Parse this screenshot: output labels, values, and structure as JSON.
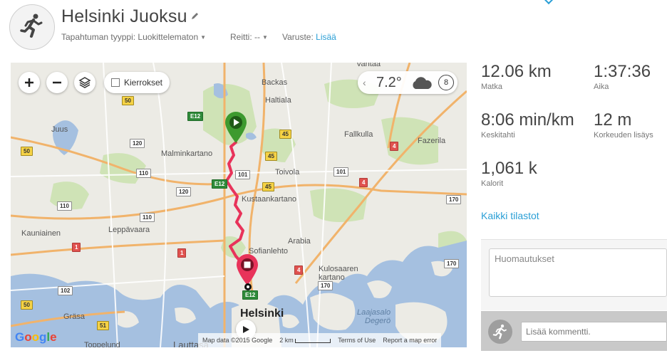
{
  "activity": {
    "title": "Helsinki Juoksu",
    "type_label": "Tapahtuman tyyppi:",
    "type_value": "Luokittelematon",
    "route_label": "Reitti:",
    "route_value": "--",
    "gear_label": "Varuste:",
    "gear_link": "Lisää"
  },
  "map": {
    "laps_label": "Kierrokset",
    "weather": {
      "temperature": "7.2°",
      "wind": "8",
      "condition_icon": "cloud-icon"
    },
    "labels": {
      "vantaa": "Vantaa",
      "backas": "Backas",
      "haltiala": "Haltiala",
      "juus": "Juus",
      "malminkartano": "Malminkartano",
      "fallkulla": "Fallkulla",
      "fazerila": "Fazerila",
      "toivola": "Toivola",
      "kustaankartano": "Kustaankartano",
      "kauniainen": "Kauniainen",
      "leppavaara": "Leppävaara",
      "arabia": "Arabia",
      "sofianlehto": "Sofianlehto",
      "kulosaaren_kartano": "Kulosaaren\nkartano",
      "helsinki": "Helsinki",
      "grasa": "Gräsa",
      "laajasalo": "Laajasalo",
      "degero": "Degerö",
      "toppelund": "Toppelund",
      "lauttasaari": "Lauttasa"
    },
    "shields": {
      "r50a": "50",
      "r50b": "50",
      "r50c": "50",
      "e12a": "E12",
      "e12b": "E12",
      "e12c": "E12",
      "r120a": "120",
      "r120b": "120",
      "r110a": "110",
      "r110b": "110",
      "r110c": "110",
      "r101a": "101",
      "r101b": "101",
      "r45a": "45",
      "r45b": "45",
      "r45c": "45",
      "r4a": "4",
      "r4b": "4",
      "r4c": "4",
      "r170a": "170",
      "r170b": "170",
      "r170c": "170",
      "r1a": "1",
      "r1b": "1",
      "r102": "102",
      "r51": "51"
    },
    "google_logo": "Google",
    "attribution": {
      "map_data": "Map data ©2015 Google",
      "scale": "2 km",
      "terms": "Terms of Use",
      "report": "Report a map error"
    },
    "colors": {
      "route": "#e8335a",
      "start": "#3d9a2e",
      "end": "#e8335a"
    }
  },
  "stats": {
    "distance": {
      "value": "12.06 km",
      "label": "Matka"
    },
    "time": {
      "value": "1:37:36",
      "label": "Aika"
    },
    "pace": {
      "value": "8:06 min/km",
      "label": "Keskitahti"
    },
    "elevation": {
      "value": "12 m",
      "label": "Korkeuden lisäys"
    },
    "calories": {
      "value": "1,061 k",
      "label": "Kalorit"
    },
    "all_stats_link": "Kaikki tilastot"
  },
  "comments": {
    "notes_placeholder": "Huomautukset",
    "comment_placeholder": "Lisää kommentti."
  },
  "icons": {
    "activity": "running-person-icon",
    "edit": "pencil-icon",
    "zoom_in": "plus-icon",
    "zoom_out": "minus-icon",
    "layers": "layers-icon",
    "play": "play-icon"
  }
}
